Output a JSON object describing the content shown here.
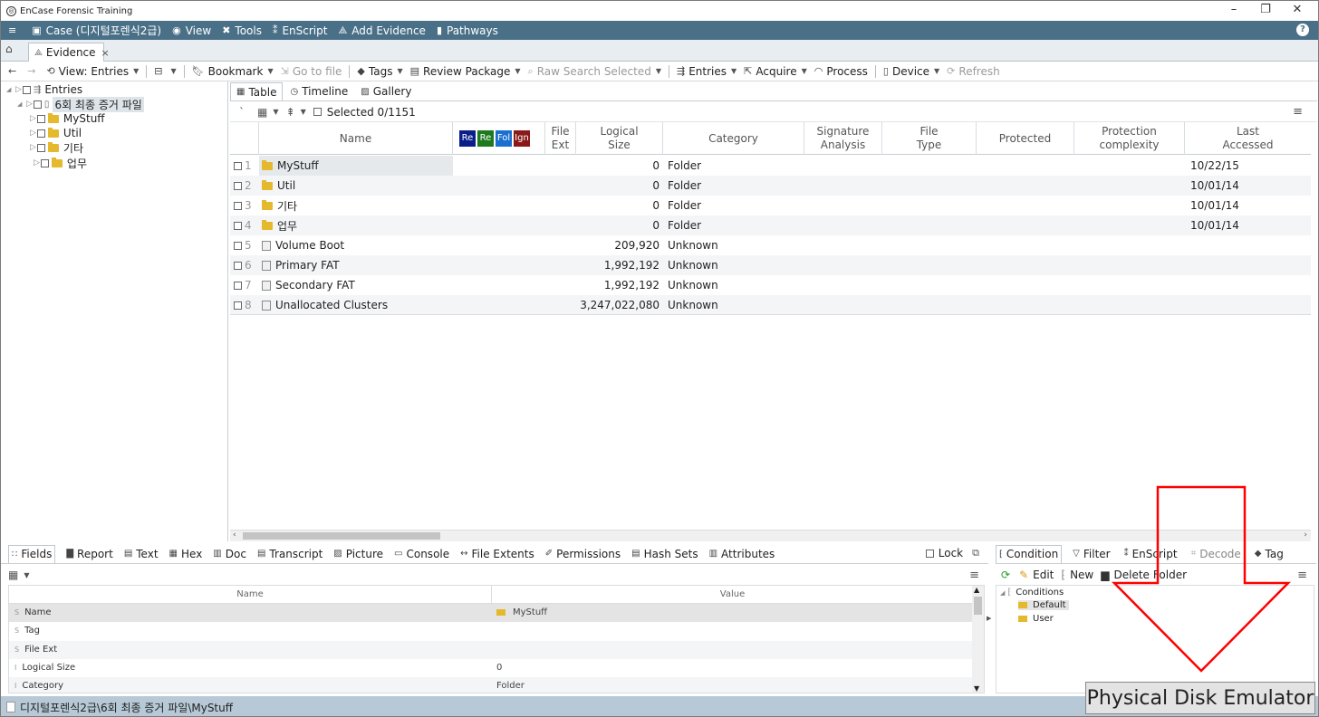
{
  "window": {
    "title": "EnCase Forensic Training",
    "controls": [
      "–",
      "❐",
      "✕"
    ]
  },
  "menu": [
    {
      "icon": "≡",
      "label": ""
    },
    {
      "icon": "▣",
      "label": "Case (디지털포렌식2급)"
    },
    {
      "icon": "◉",
      "label": "View"
    },
    {
      "icon": "✖",
      "label": "Tools"
    },
    {
      "icon": "⁑",
      "label": "EnScript"
    },
    {
      "icon": "⟁",
      "label": "Add Evidence"
    },
    {
      "icon": "▮",
      "label": "Pathways"
    }
  ],
  "help_label": "?",
  "tabs": {
    "home_icon": "⌂",
    "evidence": "Evidence",
    "close": "×"
  },
  "toolbar": {
    "back": "←",
    "forward": "→",
    "view_entries": "View: Entries",
    "bookmark": "Bookmark",
    "go_to_file": "Go to file",
    "tags": "Tags",
    "review_package": "Review Package",
    "raw_search": "Raw Search Selected",
    "entries": "Entries",
    "acquire": "Acquire",
    "process": "Process",
    "device": "Device",
    "refresh": "Refresh"
  },
  "tree": {
    "root": "Entries",
    "case": "6회 최종 증거 파일",
    "children": [
      "MyStuff",
      "Util",
      "기타",
      "업무"
    ]
  },
  "view_tabs": [
    "Table",
    "Timeline",
    "Gallery"
  ],
  "selected_label": "Selected 0/1151",
  "columns": {
    "name": "Name",
    "boxes": [
      "Re",
      "Re",
      "Fol",
      "Ign"
    ],
    "box_colors": [
      "#0b1f8a",
      "#1e7a1e",
      "#1a6fd0",
      "#8a1a1a"
    ],
    "file_ext": [
      "File",
      "Ext"
    ],
    "logical_size": [
      "Logical",
      "Size"
    ],
    "category": "Category",
    "signature": [
      "Signature",
      "Analysis"
    ],
    "file_type": [
      "File",
      "Type"
    ],
    "protected": "Protected",
    "protection": [
      "Protection",
      "complexity"
    ],
    "last_accessed": [
      "Last",
      "Accessed"
    ]
  },
  "rows": [
    {
      "n": "1",
      "name": "MyStuff",
      "size": "0",
      "category": "Folder",
      "accessed": "10/22/15",
      "folder": true
    },
    {
      "n": "2",
      "name": "Util",
      "size": "0",
      "category": "Folder",
      "accessed": "10/01/14",
      "folder": true
    },
    {
      "n": "3",
      "name": "기타",
      "size": "0",
      "category": "Folder",
      "accessed": "10/01/14",
      "folder": true
    },
    {
      "n": "4",
      "name": "업무",
      "size": "0",
      "category": "Folder",
      "accessed": "10/01/14",
      "folder": true
    },
    {
      "n": "5",
      "name": "Volume Boot",
      "size": "209,920",
      "category": "Unknown",
      "accessed": "",
      "folder": false
    },
    {
      "n": "6",
      "name": "Primary FAT",
      "size": "1,992,192",
      "category": "Unknown",
      "accessed": "",
      "folder": false
    },
    {
      "n": "7",
      "name": "Secondary FAT",
      "size": "1,992,192",
      "category": "Unknown",
      "accessed": "",
      "folder": false
    },
    {
      "n": "8",
      "name": "Unallocated Clusters",
      "size": "3,247,022,080",
      "category": "Unknown",
      "accessed": "",
      "folder": false
    }
  ],
  "bottom_tabs": [
    "Fields",
    "Report",
    "Text",
    "Hex",
    "Doc",
    "Transcript",
    "Picture",
    "Console",
    "File Extents",
    "Permissions",
    "Hash Sets",
    "Attributes"
  ],
  "lock_label": "Lock",
  "fields": {
    "header_name": "Name",
    "header_value": "Value",
    "rows": [
      {
        "type": "S",
        "key": "Name",
        "value": "MyStuff"
      },
      {
        "type": "S",
        "key": "Tag",
        "value": ""
      },
      {
        "type": "S",
        "key": "File Ext",
        "value": ""
      },
      {
        "type": "I",
        "key": "Logical Size",
        "value": "0"
      },
      {
        "type": "I",
        "key": "Category",
        "value": "Folder"
      }
    ]
  },
  "cond_tabs": [
    "Condition",
    "Filter",
    "EnScript",
    "Decode",
    "Tag"
  ],
  "cond_tools": {
    "edit": "Edit",
    "new": "New",
    "delete": "Delete",
    "folder": "Folder"
  },
  "cond_tree": {
    "root": "Conditions",
    "items": [
      "Default",
      "User"
    ]
  },
  "status_path": "디지털포렌식2급\\6회 최종 증거 파일\\MyStuff",
  "overlay_label": "Physical Disk Emulator",
  "overlay_color": "#ff0000"
}
